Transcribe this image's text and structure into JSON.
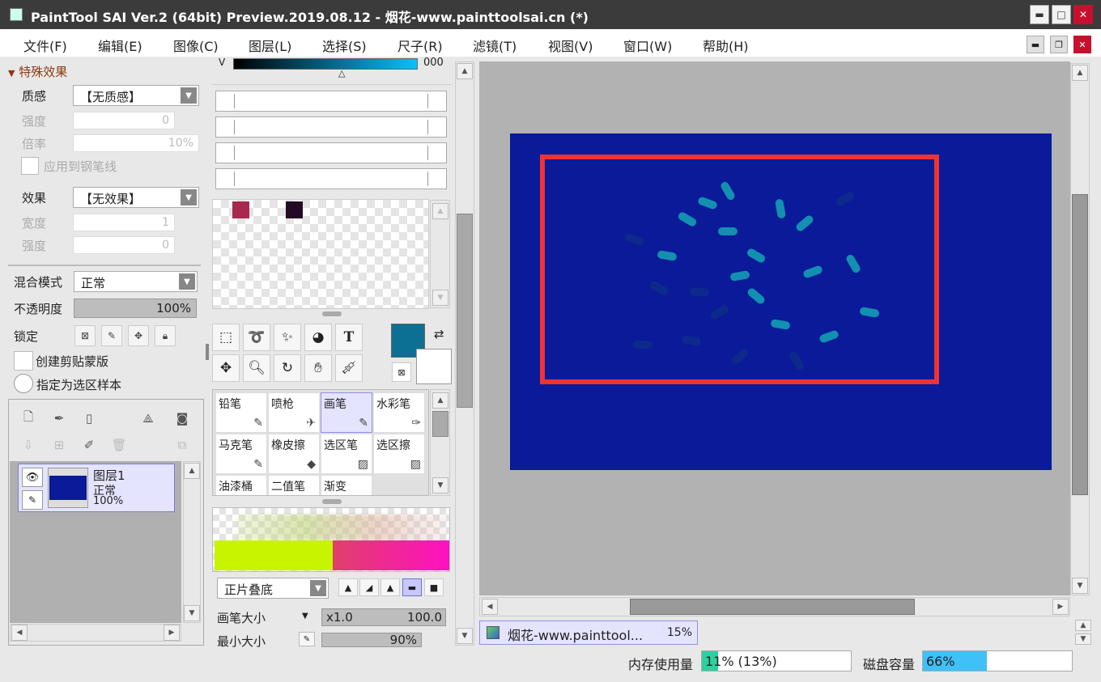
{
  "window": {
    "title": "PaintTool SAI Ver.2 (64bit) Preview.2019.08.12 - 烟花-www.painttoolsai.cn (*)",
    "minimize": "▬",
    "maximize": "□",
    "close": "✕"
  },
  "menu": {
    "items": [
      "文件(F)",
      "编辑(E)",
      "图像(C)",
      "图层(L)",
      "选择(S)",
      "尺子(R)",
      "滤镜(T)",
      "视图(V)",
      "窗口(W)",
      "帮助(H)"
    ]
  },
  "effects": {
    "header": "特殊效果",
    "texture_label": "质感",
    "texture_value": "【无质感】",
    "strength_label": "强度",
    "strength_value": "0",
    "scale_label": "倍率",
    "scale_value": "10%",
    "apply_pen_label": "应用到钢笔线",
    "effect_label": "效果",
    "effect_value": "【无效果】",
    "width_label": "宽度",
    "width_value": "1",
    "strength2_label": "强度",
    "strength2_value": "0"
  },
  "layer_props": {
    "blend_label": "混合模式",
    "blend_value": "正常",
    "opacity_label": "不透明度",
    "opacity_value": "100%",
    "lock_label": "锁定",
    "clip_label": "创建剪贴蒙版",
    "sample_label": "指定为选区样本"
  },
  "layers": [
    {
      "name": "图层1",
      "mode": "正常",
      "opacity": "100%"
    }
  ],
  "color": {
    "v_label": "V",
    "v_value": "000",
    "primary": "#0b7094",
    "secondary": "#ffffff",
    "swatches": [
      "#a8284f",
      "#240a24"
    ]
  },
  "tools": {
    "text_glyph": "T"
  },
  "brushes": [
    {
      "name": "铅笔",
      "icon": "✎",
      "selected": false
    },
    {
      "name": "喷枪",
      "icon": "✈",
      "selected": false
    },
    {
      "name": "画笔",
      "icon": "✎",
      "selected": true
    },
    {
      "name": "水彩笔",
      "icon": "✑",
      "selected": false
    },
    {
      "name": "马克笔",
      "icon": "✎",
      "selected": false
    },
    {
      "name": "橡皮擦",
      "icon": "◆",
      "selected": false
    },
    {
      "name": "选区笔",
      "icon": "▨",
      "selected": false
    },
    {
      "name": "选区擦",
      "icon": "▨",
      "selected": false
    },
    {
      "name": "油漆桶",
      "icon": "",
      "selected": false
    },
    {
      "name": "二值笔",
      "icon": "",
      "selected": false
    },
    {
      "name": "渐变",
      "icon": "",
      "selected": false
    }
  ],
  "brush_settings": {
    "blend_mode": "正片叠底",
    "size_label": "画笔大小",
    "size_mult": "x1.0",
    "size_value": "100.0",
    "min_size_label": "最小大小",
    "min_size_value": "90%"
  },
  "canvas": {
    "bg": "#0a1a99",
    "selection_color": "#ee3333"
  },
  "document": {
    "name": "烟花-www.painttool...",
    "zoom": "15%"
  },
  "status": {
    "memory_label": "内存使用量",
    "memory_value": "11% (13%)",
    "memory_fill": 0.11,
    "disk_label": "磁盘容量",
    "disk_value": "66%",
    "disk_fill": 0.66
  }
}
